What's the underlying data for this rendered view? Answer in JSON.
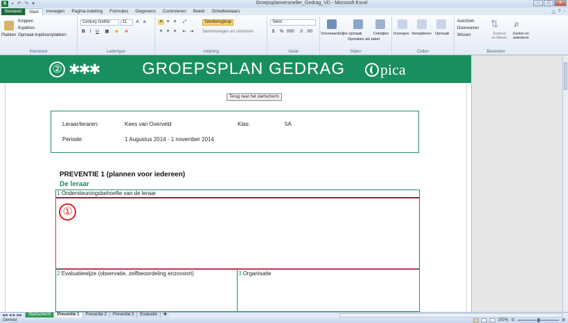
{
  "window": {
    "title": "Groepsplanversneller_Gedrag_VD - Microsoft Excel",
    "app_logo": "X"
  },
  "ribbon_tabs": [
    "Bestand",
    "Start",
    "Invoegen",
    "Pagina-indeling",
    "Formules",
    "Gegevens",
    "Controleren",
    "Beeld",
    "Ontwikkelaars"
  ],
  "ribbon": {
    "clipboard": {
      "paste": "Plakken",
      "cut": "Knippen",
      "copy": "Kopiëren",
      "format_painter": "Opmaak kopiëren/plakken",
      "label": "Klembord"
    },
    "font": {
      "family": "Century Gothic",
      "size": "11",
      "label": "Lettertype"
    },
    "alignment": {
      "wrap_text": "Tekstterugloop",
      "merge": "Samenvoegen en centreren",
      "label": "Uitlijning"
    },
    "number": {
      "format": "Tekst",
      "label": "Getal"
    },
    "styles": {
      "conditional": "Voorwaardelijke opmaak",
      "format_table": "Opmaken als tabel",
      "cell_styles": "Celstijlen",
      "label": "Stijlen"
    },
    "cells": {
      "insert": "Invoegen",
      "delete": "Verwijderen",
      "format": "Opmaak",
      "label": "Cellen"
    },
    "editing": {
      "autosum": "AutoSom",
      "fill": "Doorvoeren",
      "clear": "Wissen",
      "sort": "Sorteren en filteren",
      "find": "Zoeken en selecteren",
      "label": "Bewerken"
    }
  },
  "sheet": {
    "banner_number": "②",
    "banner_title": "GROEPSPLAN GEDRAG",
    "logo_text": "pica",
    "start_button": "Terug naar het startscherm",
    "teacher_label": "Leraar/leraren:",
    "teacher_value": "Kees van Overveld",
    "class_label": "Klas:",
    "class_value": "5A",
    "period_label": "Periode:",
    "period_value": "1 Augustus 2014 - 1 november 2014",
    "prevention_title": "PREVENTIE 1 (plannen voor iedereen)",
    "prevention_subtitle": "De leraar",
    "box1_num": "1",
    "box1_label": "Ondersteuningsbehoefte van de leraar",
    "marker": "①",
    "box2_num": "2",
    "box2_label": "Evaluatiewijze (observatie, zelfbeoordeling enzovoort)",
    "box3_num": "3",
    "box3_label": "Organisatie"
  },
  "sheet_tabs": [
    "Startscherm",
    "Preventie 1",
    "Preventie 2",
    "Preventie 3",
    "Evaluatie"
  ],
  "status": {
    "mode": "Gereed",
    "zoom": "100%"
  },
  "colors": {
    "brand_green": "#1a8f5e",
    "marker_red": "#e02424"
  }
}
